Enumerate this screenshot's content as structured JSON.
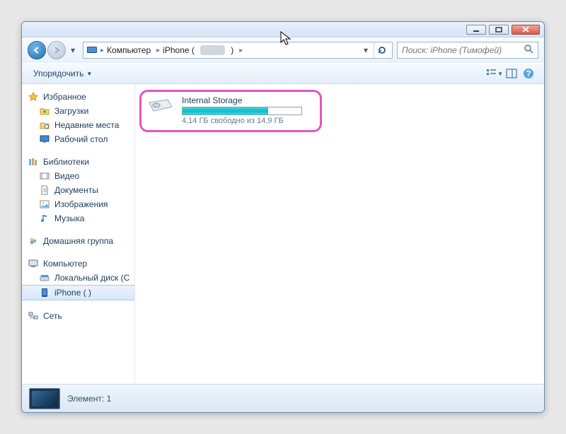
{
  "breadcrumb": {
    "root": "Компьютер",
    "second": "iPhone ("
  },
  "search": {
    "placeholder": "Поиск: iPhone (Тимофей)"
  },
  "toolbar": {
    "organize": "Упорядочить"
  },
  "sidebar": {
    "favorites": {
      "label": "Избранное",
      "items": [
        "Загрузки",
        "Недавние места",
        "Рабочий стол"
      ]
    },
    "libraries": {
      "label": "Библиотеки",
      "items": [
        "Видео",
        "Документы",
        "Изображения",
        "Музыка"
      ]
    },
    "homegroup": {
      "label": "Домашняя группа"
    },
    "computer": {
      "label": "Компьютер",
      "items": [
        "Локальный диск (C",
        "iPhone (             )"
      ]
    },
    "network": {
      "label": "Сеть"
    }
  },
  "drive": {
    "title": "Internal Storage",
    "text": "4,14 ГБ свободно из 14,9 ГБ",
    "used_pct": 72
  },
  "status": {
    "text": "Элемент: 1"
  }
}
